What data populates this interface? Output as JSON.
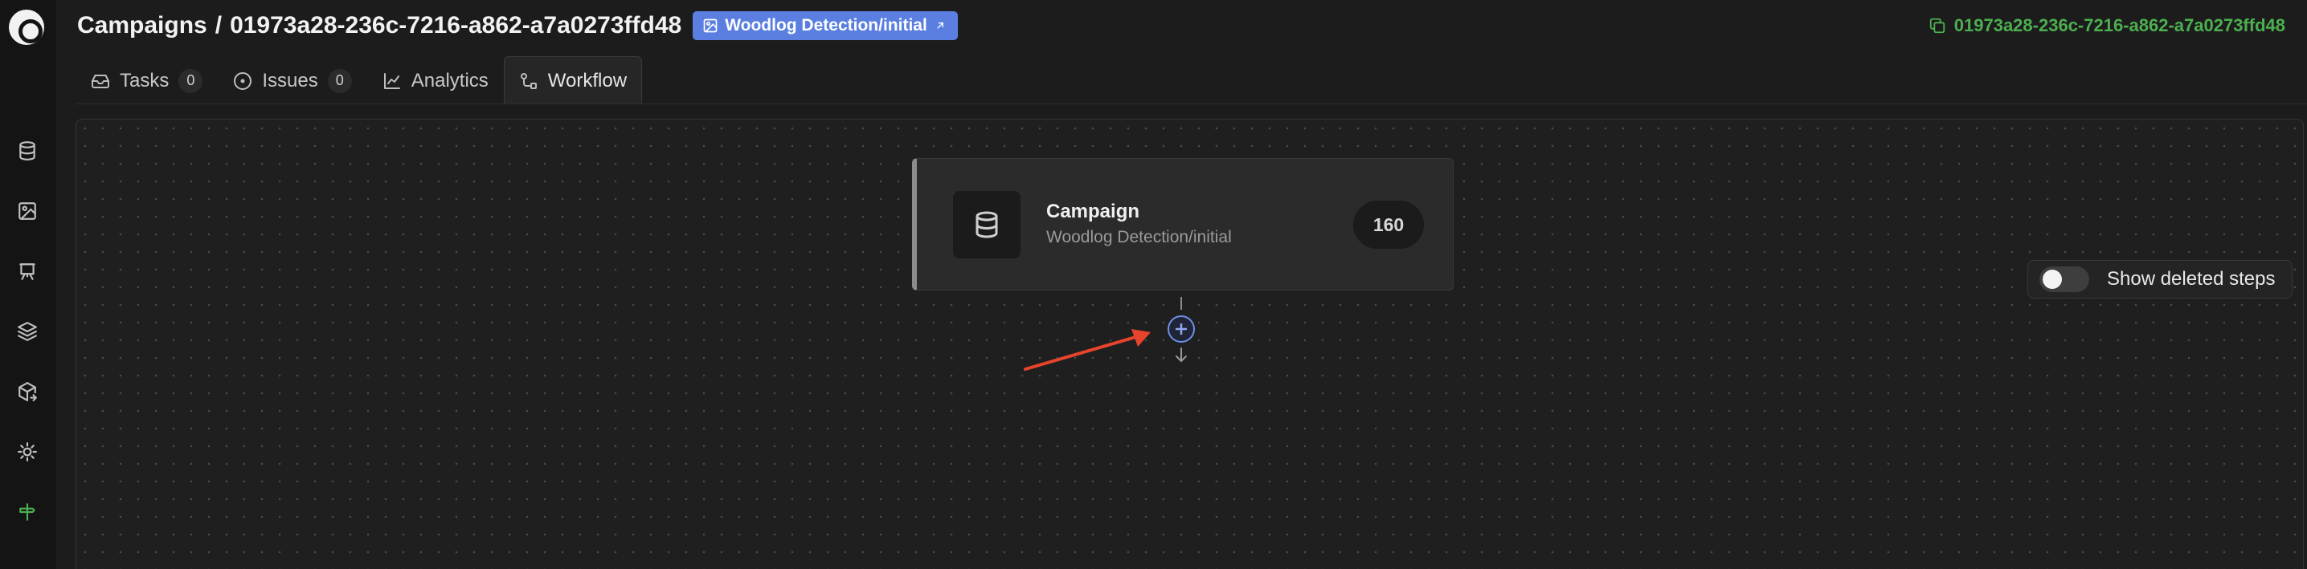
{
  "breadcrumb": {
    "section": "Campaigns",
    "separator": "/",
    "campaign_id": "01973a28-236c-7216-a862-a7a0273ffd48"
  },
  "dataset_badge": {
    "label": "Woodlog Detection/initial",
    "icon": "image-icon"
  },
  "copy_id": {
    "label": "01973a28-236c-7216-a862-a7a0273ffd48",
    "icon": "copy-icon",
    "color": "#4caf50"
  },
  "tabs": [
    {
      "label": "Tasks",
      "count": "0",
      "icon": "inbox-icon"
    },
    {
      "label": "Issues",
      "count": "0",
      "icon": "circle-dot-icon"
    },
    {
      "label": "Analytics",
      "icon": "line-chart-icon"
    },
    {
      "label": "Workflow",
      "icon": "workflow-icon",
      "active": true
    }
  ],
  "sidebar": {
    "icons": [
      "database-icon",
      "image-icon",
      "easel-icon",
      "layers-icon",
      "box-export-icon",
      "cog-icon",
      "signpost-icon"
    ],
    "active": "signpost-icon",
    "active_color": "#4caf50"
  },
  "workflow": {
    "node": {
      "title": "Campaign",
      "subtitle": "Woodlog Detection/initial",
      "count": "160",
      "icon": "database-icon"
    },
    "add_step_icon": "plus-circle-icon",
    "show_deleted_label": "Show deleted steps",
    "show_deleted_enabled": false,
    "settings_icon": "gear-icon",
    "accent_color": "#5a7fe0"
  }
}
